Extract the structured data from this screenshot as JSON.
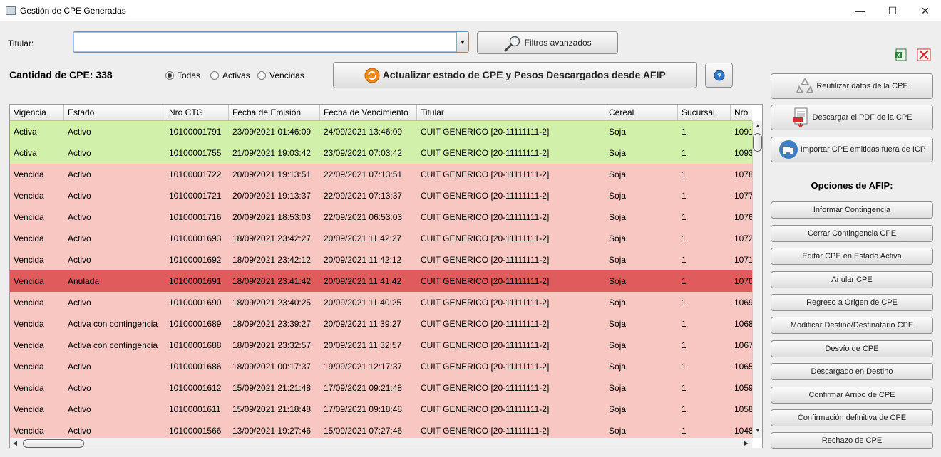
{
  "window": {
    "title": "Gestión de CPE Generadas",
    "minimize": "—",
    "maximize": "☐",
    "close": "✕"
  },
  "filters": {
    "titular_label": "Titular:",
    "titular_value": "",
    "advanced_button": "Filtros avanzados"
  },
  "summary": {
    "count_label": "Cantidad de CPE: 338"
  },
  "radio": {
    "options": [
      {
        "label": "Todas",
        "selected": true
      },
      {
        "label": "Activas",
        "selected": false
      },
      {
        "label": "Vencidas",
        "selected": false
      }
    ]
  },
  "update_button": "Actualizar estado de CPE y Pesos Descargados desde AFIP",
  "help_icon": "question-icon",
  "table": {
    "columns": [
      "Vigencia",
      "Estado",
      "Nro CTG",
      "Fecha de Emisión",
      "Fecha de Vencimiento",
      "Titular",
      "Cereal",
      "Sucursal",
      "Nro"
    ],
    "rows": [
      {
        "style": "green",
        "cells": [
          "Activa",
          "Activo",
          "10100001791",
          "23/09/2021 01:46:09",
          "24/09/2021 13:46:09",
          "CUIT GENERICO [20-11111111-2]",
          "Soja",
          "1",
          "1091"
        ]
      },
      {
        "style": "green",
        "cells": [
          "Activa",
          "Activo",
          "10100001755",
          "21/09/2021 19:03:42",
          "23/09/2021 07:03:42",
          "CUIT GENERICO [20-11111111-2]",
          "Soja",
          "1",
          "1093"
        ]
      },
      {
        "style": "red",
        "cells": [
          "Vencida",
          "Activo",
          "10100001722",
          "20/09/2021 19:13:51",
          "22/09/2021 07:13:51",
          "CUIT GENERICO [20-11111111-2]",
          "Soja",
          "1",
          "1078"
        ]
      },
      {
        "style": "red",
        "cells": [
          "Vencida",
          "Activo",
          "10100001721",
          "20/09/2021 19:13:37",
          "22/09/2021 07:13:37",
          "CUIT GENERICO [20-11111111-2]",
          "Soja",
          "1",
          "1077"
        ]
      },
      {
        "style": "red",
        "cells": [
          "Vencida",
          "Activo",
          "10100001716",
          "20/09/2021 18:53:03",
          "22/09/2021 06:53:03",
          "CUIT GENERICO [20-11111111-2]",
          "Soja",
          "1",
          "1076"
        ]
      },
      {
        "style": "red",
        "cells": [
          "Vencida",
          "Activo",
          "10100001693",
          "18/09/2021 23:42:27",
          "20/09/2021 11:42:27",
          "CUIT GENERICO [20-11111111-2]",
          "Soja",
          "1",
          "1072"
        ]
      },
      {
        "style": "red",
        "cells": [
          "Vencida",
          "Activo",
          "10100001692",
          "18/09/2021 23:42:12",
          "20/09/2021 11:42:12",
          "CUIT GENERICO [20-11111111-2]",
          "Soja",
          "1",
          "1071"
        ]
      },
      {
        "style": "dark",
        "cells": [
          "Vencida",
          "Anulada",
          "10100001691",
          "18/09/2021 23:41:42",
          "20/09/2021 11:41:42",
          "CUIT GENERICO [20-11111111-2]",
          "Soja",
          "1",
          "1070"
        ]
      },
      {
        "style": "red",
        "cells": [
          "Vencida",
          "Activo",
          "10100001690",
          "18/09/2021 23:40:25",
          "20/09/2021 11:40:25",
          "CUIT GENERICO [20-11111111-2]",
          "Soja",
          "1",
          "1069"
        ]
      },
      {
        "style": "red",
        "cells": [
          "Vencida",
          "Activa con contingencia",
          "10100001689",
          "18/09/2021 23:39:27",
          "20/09/2021 11:39:27",
          "CUIT GENERICO [20-11111111-2]",
          "Soja",
          "1",
          "1068"
        ]
      },
      {
        "style": "red",
        "cells": [
          "Vencida",
          "Activa con contingencia",
          "10100001688",
          "18/09/2021 23:32:57",
          "20/09/2021 11:32:57",
          "CUIT GENERICO [20-11111111-2]",
          "Soja",
          "1",
          "1067"
        ]
      },
      {
        "style": "red",
        "cells": [
          "Vencida",
          "Activo",
          "10100001686",
          "18/09/2021 00:17:37",
          "19/09/2021 12:17:37",
          "CUIT GENERICO [20-11111111-2]",
          "Soja",
          "1",
          "1065"
        ]
      },
      {
        "style": "red",
        "cells": [
          "Vencida",
          "Activo",
          "10100001612",
          "15/09/2021 21:21:48",
          "17/09/2021 09:21:48",
          "CUIT GENERICO [20-11111111-2]",
          "Soja",
          "1",
          "1059"
        ]
      },
      {
        "style": "red",
        "cells": [
          "Vencida",
          "Activo",
          "10100001611",
          "15/09/2021 21:18:48",
          "17/09/2021 09:18:48",
          "CUIT GENERICO [20-11111111-2]",
          "Soja",
          "1",
          "1058"
        ]
      },
      {
        "style": "red",
        "cells": [
          "Vencida",
          "Activo",
          "10100001566",
          "13/09/2021 19:27:46",
          "15/09/2021 07:27:46",
          "CUIT GENERICO [20-11111111-2]",
          "Soja",
          "1",
          "1048"
        ]
      }
    ]
  },
  "sidebar": {
    "top_buttons": [
      {
        "label": "Reutilizar datos de la CPE",
        "icon": "recycle-icon"
      },
      {
        "label": "Descargar el PDF de la CPE",
        "icon": "pdf-icon"
      },
      {
        "label": "Importar CPE emitidas fuera de ICP",
        "icon": "truck-icon"
      }
    ],
    "afip_heading": "Opciones de AFIP:",
    "afip_buttons": [
      "Informar Contingencia",
      "Cerrar Contingencia CPE",
      "Editar CPE en Estado Activa",
      "Anular CPE",
      "Regreso a Origen de CPE",
      "Modificar Destino/Destinatario CPE",
      "Desvío de CPE",
      "Descargado en Destino",
      "Confirmar Arribo de CPE",
      "Confirmación definitiva de CPE",
      "Rechazo de CPE"
    ]
  },
  "toolbar_icons": {
    "excel": "excel-icon",
    "close": "close-icon"
  },
  "colors": {
    "green_row": "#d1f0a9",
    "red_row": "#f8c7c1",
    "dark_red_row": "#e05b5b"
  }
}
